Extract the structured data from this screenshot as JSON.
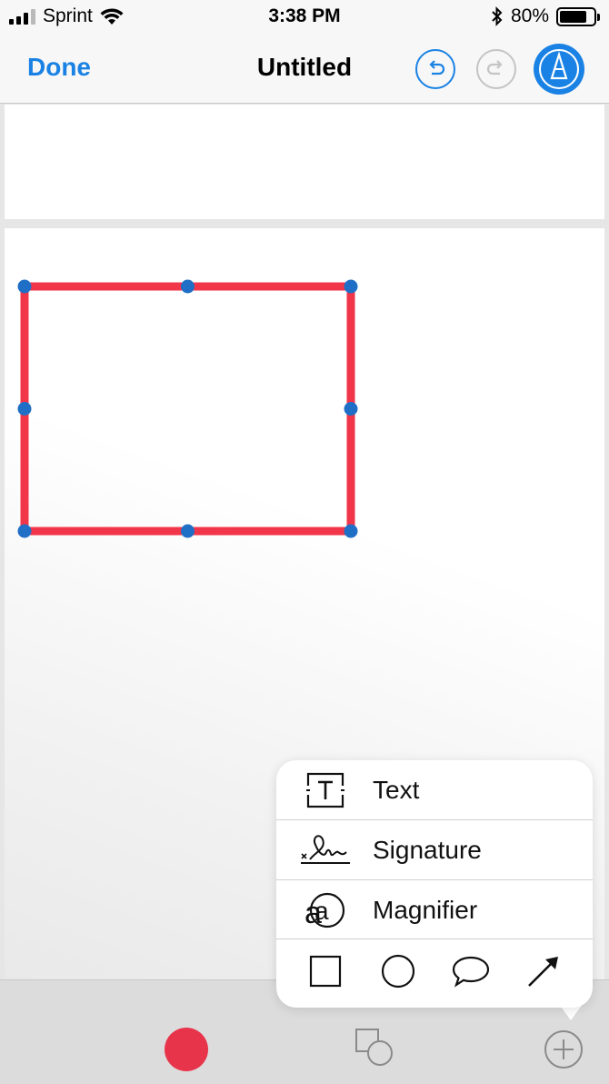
{
  "status_bar": {
    "carrier": "Sprint",
    "time": "3:38 PM",
    "battery_percent": "80%",
    "battery_level": 0.8,
    "icons": [
      "signal-icon",
      "wifi-icon",
      "bluetooth-icon",
      "battery-icon"
    ]
  },
  "nav_bar": {
    "done_label": "Done",
    "title": "Untitled",
    "icons": [
      "undo-icon",
      "redo-icon",
      "markup-pen-icon"
    ],
    "accent_color": "#1a82e4"
  },
  "canvas": {
    "shape": "rectangle",
    "stroke_color": "#f2364a",
    "handle_color": "#1f6fc6",
    "selected": true
  },
  "popup_menu": {
    "items": [
      {
        "label": "Text",
        "icon": "text-box-icon"
      },
      {
        "label": "Signature",
        "icon": "signature-icon"
      },
      {
        "label": "Magnifier",
        "icon": "magnifier-icon"
      }
    ],
    "shapes": [
      "square-shape-icon",
      "circle-shape-icon",
      "speech-bubble-shape-icon",
      "arrow-shape-icon"
    ]
  },
  "bottom_toolbar": {
    "color_swatch": "#e8344a",
    "icons": [
      "color-picker-icon",
      "shapes-icon",
      "add-icon"
    ]
  }
}
